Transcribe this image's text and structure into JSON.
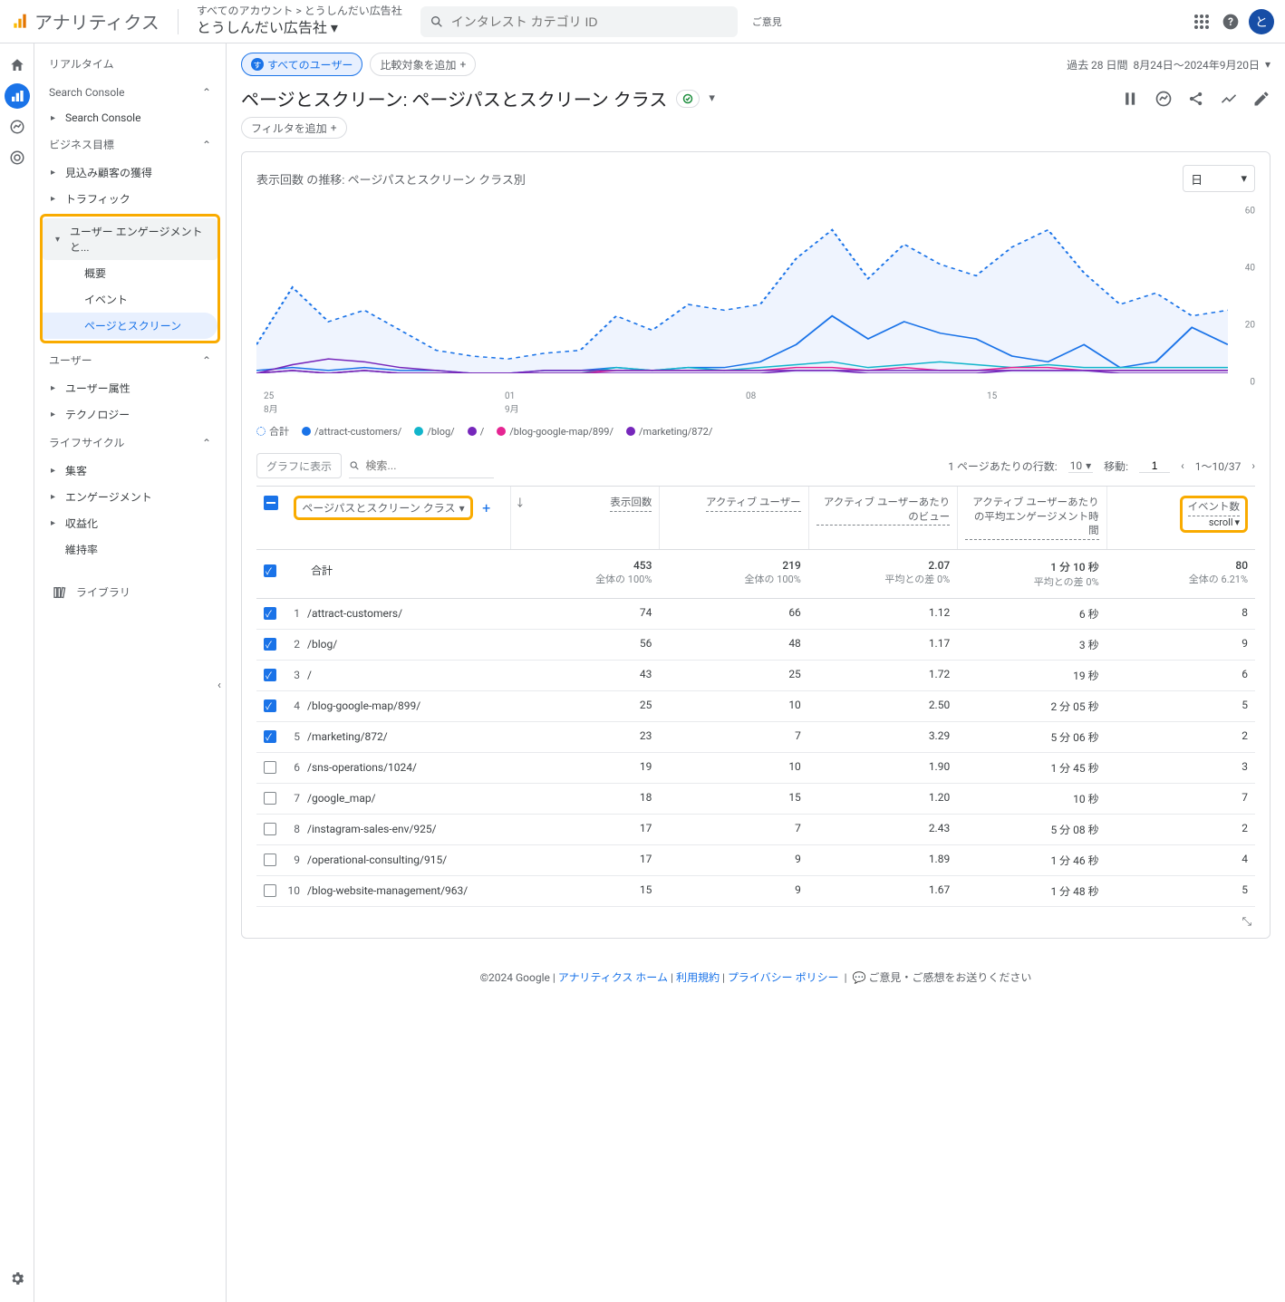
{
  "header": {
    "brand": "アナリティクス",
    "breadcrumb": "すべてのアカウント > とうしんだい広告社",
    "property": "とうしんだい広告社",
    "search_placeholder": "インタレスト カテゴリ ID",
    "feedback": "ご意見",
    "avatar_letter": "と"
  },
  "sidebar": {
    "realtime": "リアルタイム",
    "search_console_head": "Search Console",
    "search_console_item": "Search Console",
    "biz_head": "ビジネス目標",
    "biz_items": [
      "見込み顧客の獲得",
      "トラフィック",
      "ユーザー エンゲージメントと...",
      "概要",
      "イベント",
      "ページとスクリーン"
    ],
    "user_head": "ユーザー",
    "user_items": [
      "ユーザー属性",
      "テクノロジー"
    ],
    "life_head": "ライフサイクル",
    "life_items": [
      "集客",
      "エンゲージメント",
      "収益化",
      "維持率"
    ],
    "library": "ライブラリ"
  },
  "main": {
    "chip_all_users": "すべてのユーザー",
    "chip_all_users_badge": "す",
    "chip_add_compare": "比較対象を追加",
    "date_prefix": "過去 28 日間",
    "date_range": "8月24日～2024年9月20日",
    "title": "ページとスクリーン: ページパスとスクリーン クラス",
    "add_filter": "フィルタを追加"
  },
  "chart": {
    "title": "表示回数 の推移: ページパスとスクリーン クラス別",
    "granularity": "日",
    "legend": [
      "合計",
      "/attract-customers/",
      "/blog/",
      "/",
      "/blog-google-map/899/",
      "/marketing/872/"
    ],
    "legend_colors": [
      "#1a73e8",
      "#1a73e8",
      "#12b5cb",
      "#7627bb",
      "#e52592",
      "#7627bb"
    ],
    "xticks": [
      "25\n8月",
      "01\n9月",
      "08",
      "15"
    ]
  },
  "chart_data": {
    "type": "line",
    "ylim": [
      0,
      60
    ],
    "yticks": [
      0,
      20,
      40,
      60
    ],
    "x": [
      "24",
      "25",
      "26",
      "27",
      "28",
      "29",
      "30",
      "31",
      "01",
      "02",
      "03",
      "04",
      "05",
      "06",
      "07",
      "08",
      "09",
      "10",
      "11",
      "12",
      "13",
      "14",
      "15",
      "16",
      "17",
      "18",
      "19",
      "20"
    ],
    "series": [
      {
        "name": "合計",
        "style": "dotted",
        "color": "#1a73e8",
        "values": [
          10,
          30,
          18,
          22,
          15,
          8,
          6,
          5,
          7,
          8,
          20,
          15,
          24,
          22,
          24,
          40,
          50,
          33,
          45,
          38,
          34,
          44,
          50,
          35,
          24,
          28,
          20,
          22
        ]
      },
      {
        "name": "/attract-customers/",
        "color": "#1a73e8",
        "values": [
          1,
          2,
          1,
          2,
          1,
          1,
          0,
          0,
          1,
          1,
          2,
          1,
          2,
          2,
          4,
          10,
          20,
          12,
          18,
          14,
          12,
          6,
          4,
          10,
          2,
          4,
          16,
          10
        ]
      },
      {
        "name": "/blog/",
        "color": "#12b5cb",
        "values": [
          0,
          1,
          0,
          1,
          0,
          0,
          0,
          0,
          0,
          0,
          2,
          1,
          2,
          1,
          2,
          3,
          4,
          2,
          3,
          4,
          3,
          2,
          3,
          2,
          2,
          2,
          2,
          2
        ]
      },
      {
        "name": "/",
        "color": "#e52592",
        "values": [
          0,
          1,
          0,
          1,
          0,
          0,
          0,
          0,
          0,
          0,
          1,
          1,
          1,
          1,
          1,
          2,
          2,
          1,
          2,
          1,
          1,
          2,
          2,
          1,
          1,
          1,
          1,
          1
        ]
      },
      {
        "name": "/blog-google-map/899/",
        "color": "#7627bb",
        "values": [
          0,
          3,
          5,
          4,
          2,
          1,
          0,
          0,
          1,
          1,
          1,
          1,
          1,
          1,
          1,
          1,
          1,
          0,
          0,
          0,
          0,
          1,
          1,
          1,
          0,
          0,
          0,
          0
        ]
      },
      {
        "name": "/marketing/872/",
        "color": "#7627bb",
        "values": [
          0,
          1,
          0,
          1,
          0,
          0,
          0,
          0,
          0,
          0,
          0,
          0,
          0,
          0,
          0,
          1,
          1,
          1,
          1,
          1,
          1,
          1,
          1,
          1,
          1,
          1,
          1,
          1
        ]
      }
    ]
  },
  "table_ctrl": {
    "plot_btn": "グラフに表示",
    "search_ph": "検索...",
    "rows_per_page_label": "1 ページあたりの行数:",
    "rows_per_page": "10",
    "goto_label": "移動:",
    "goto_value": "1",
    "range": "1～10/37"
  },
  "table": {
    "dim_label": "ページパスとスクリーン クラス",
    "columns": [
      "表示回数",
      "アクティブ ユーザー",
      "アクティブ ユーザーあたりのビュー",
      "アクティブ ユーザーあたりの平均エンゲージメント時間",
      "イベント数"
    ],
    "event_selected": "scroll",
    "totals_label": "合計",
    "totals": {
      "views": "453",
      "views_sub": "全体の 100%",
      "users": "219",
      "users_sub": "全体の 100%",
      "vpu": "2.07",
      "vpu_sub": "平均との差 0%",
      "avg": "1 分 10 秒",
      "avg_sub": "平均との差 0%",
      "events": "80",
      "events_sub": "全体の 6.21%"
    },
    "rows": [
      {
        "checked": true,
        "idx": "1",
        "path": "/attract-customers/",
        "views": "74",
        "users": "66",
        "vpu": "1.12",
        "avg": "6 秒",
        "events": "8"
      },
      {
        "checked": true,
        "idx": "2",
        "path": "/blog/",
        "views": "56",
        "users": "48",
        "vpu": "1.17",
        "avg": "3 秒",
        "events": "9"
      },
      {
        "checked": true,
        "idx": "3",
        "path": "/",
        "views": "43",
        "users": "25",
        "vpu": "1.72",
        "avg": "19 秒",
        "events": "6"
      },
      {
        "checked": true,
        "idx": "4",
        "path": "/blog-google-map/899/",
        "views": "25",
        "users": "10",
        "vpu": "2.50",
        "avg": "2 分 05 秒",
        "events": "5"
      },
      {
        "checked": true,
        "idx": "5",
        "path": "/marketing/872/",
        "views": "23",
        "users": "7",
        "vpu": "3.29",
        "avg": "5 分 06 秒",
        "events": "2"
      },
      {
        "checked": false,
        "idx": "6",
        "path": "/sns-operations/1024/",
        "views": "19",
        "users": "10",
        "vpu": "1.90",
        "avg": "1 分 45 秒",
        "events": "3"
      },
      {
        "checked": false,
        "idx": "7",
        "path": "/google_map/",
        "views": "18",
        "users": "15",
        "vpu": "1.20",
        "avg": "10 秒",
        "events": "7"
      },
      {
        "checked": false,
        "idx": "8",
        "path": "/instagram-sales-env/925/",
        "views": "17",
        "users": "7",
        "vpu": "2.43",
        "avg": "5 分 08 秒",
        "events": "2"
      },
      {
        "checked": false,
        "idx": "9",
        "path": "/operational-consulting/915/",
        "views": "17",
        "users": "9",
        "vpu": "1.89",
        "avg": "1 分 46 秒",
        "events": "4"
      },
      {
        "checked": false,
        "idx": "10",
        "path": "/blog-website-management/963/",
        "views": "15",
        "users": "9",
        "vpu": "1.67",
        "avg": "1 分 48 秒",
        "events": "5"
      }
    ]
  },
  "footer": {
    "copyright": "©2024 Google",
    "links": [
      "アナリティクス ホーム",
      "利用規約",
      "プライバシー ポリシー"
    ],
    "feedback": "ご意見・ご感想をお送りください"
  }
}
